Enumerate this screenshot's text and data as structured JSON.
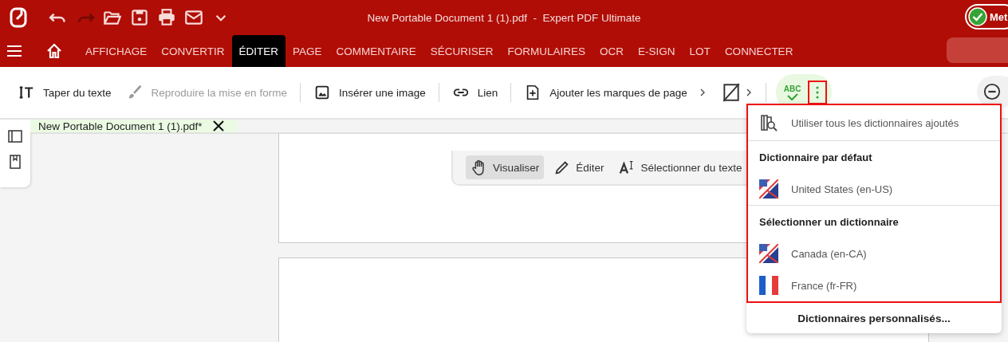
{
  "window": {
    "title": "New Portable Document 1 (1).pdf  -  Expert PDF Ultimate",
    "account_badge": "Met"
  },
  "quick_access": [
    {
      "disabled": false
    },
    {
      "disabled": true
    },
    {
      "disabled": false
    },
    {
      "disabled": false
    },
    {
      "disabled": false
    },
    {
      "disabled": false
    },
    {
      "disabled": false
    }
  ],
  "menu_tabs": [
    {
      "label": "AFFICHAGE",
      "selected": false
    },
    {
      "label": "CONVERTIR",
      "selected": false
    },
    {
      "label": "ÉDITER",
      "selected": true
    },
    {
      "label": "PAGE",
      "selected": false
    },
    {
      "label": "COMMENTAIRE",
      "selected": false
    },
    {
      "label": "SÉCURISER",
      "selected": false
    },
    {
      "label": "FORMULAIRES",
      "selected": false
    },
    {
      "label": "OCR",
      "selected": false
    },
    {
      "label": "E-SIGN",
      "selected": false
    },
    {
      "label": "LOT",
      "selected": false
    },
    {
      "label": "CONNECTER",
      "selected": false
    }
  ],
  "toolbar": [
    {
      "kind": "button",
      "label": "Taper du texte",
      "disabled": false
    },
    {
      "kind": "button",
      "label": "Reproduire la mise en forme",
      "disabled": true
    },
    {
      "kind": "separator"
    },
    {
      "kind": "button",
      "label": "Insérer une image",
      "disabled": false
    },
    {
      "kind": "separator"
    },
    {
      "kind": "button",
      "label": "Lien",
      "disabled": false
    },
    {
      "kind": "separator"
    },
    {
      "kind": "button",
      "label": "Ajouter les marques de page",
      "disabled": false,
      "submenu": true
    },
    {
      "kind": "icon",
      "disabled": false,
      "submenu": true
    },
    {
      "kind": "separator"
    },
    {
      "kind": "spellcheck",
      "label": "ABC"
    }
  ],
  "document_tab": {
    "label": "New Portable Document 1 (1).pdf*"
  },
  "mode_toolbar": [
    {
      "label": "Visualiser",
      "selected": true
    },
    {
      "label": "Éditer",
      "selected": false
    },
    {
      "label": "Sélectionner du texte",
      "selected": false
    }
  ],
  "dictionary_menu": {
    "items": [
      {
        "kind": "action",
        "label": "Utiliser tous les dictionnaires ajoutés"
      },
      {
        "kind": "header",
        "label": "Dictionnaire par défaut"
      },
      {
        "kind": "english",
        "label": "United States (en-US)"
      },
      {
        "kind": "header",
        "label": "Sélectionner un dictionnaire"
      },
      {
        "kind": "english",
        "label": "Canada (en-CA)"
      },
      {
        "kind": "french",
        "label": "France (fr-FR)"
      }
    ],
    "footer": "Dictionnaires personnalisés..."
  }
}
